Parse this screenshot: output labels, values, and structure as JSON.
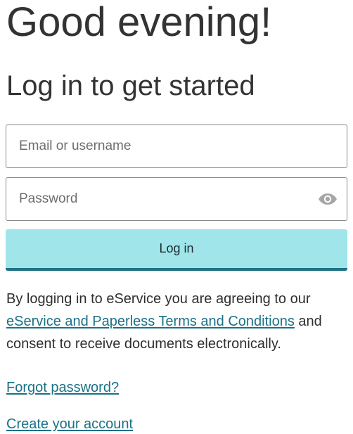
{
  "greeting": "Good evening!",
  "subheading": "Log in to get started",
  "email": {
    "placeholder": "Email or username",
    "value": ""
  },
  "password": {
    "placeholder": "Password",
    "value": "",
    "toggle_icon": "eye-icon"
  },
  "login_button": {
    "label": "Log in"
  },
  "terms": {
    "prefix": "By logging in to eService you are agreeing to our",
    "link": "eService and Paperless Terms and Conditions",
    "suffix": "and consent to receive documents electronically."
  },
  "links": {
    "forgot_password": "Forgot password?",
    "create_account": "Create your account"
  },
  "colors": {
    "button_bg": "#9fe5e9",
    "button_border": "#1e7283",
    "link": "#1b7187",
    "field_border": "#8a8a8a"
  }
}
